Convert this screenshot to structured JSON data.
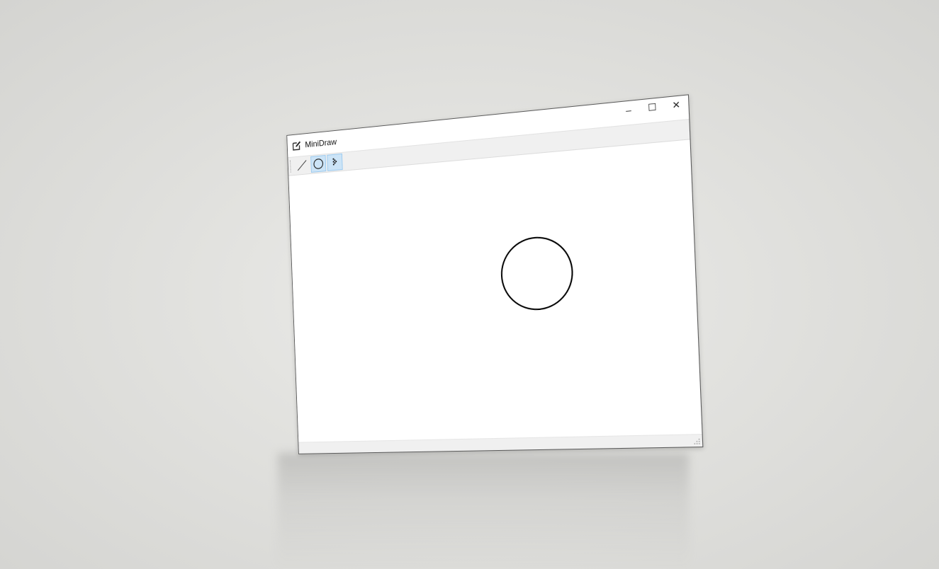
{
  "window": {
    "title": "MiniDraw",
    "icon": "edit-icon",
    "controls": {
      "minimize": "–",
      "maximize": "☐",
      "close": "✕"
    }
  },
  "toolbar": {
    "tools": [
      {
        "name": "line",
        "icon": "line-tool-icon",
        "active": false
      },
      {
        "name": "ellipse",
        "icon": "ellipse-tool-icon",
        "active": true
      },
      {
        "name": "select",
        "icon": "select-tool-icon",
        "active": true
      }
    ]
  },
  "canvas": {
    "shapes": [
      {
        "type": "circle",
        "stroke": "#000000"
      }
    ]
  },
  "colors": {
    "toolbar_bg": "#f0f0f0",
    "active_tool": "#cce4f7",
    "canvas_bg": "#ffffff"
  }
}
